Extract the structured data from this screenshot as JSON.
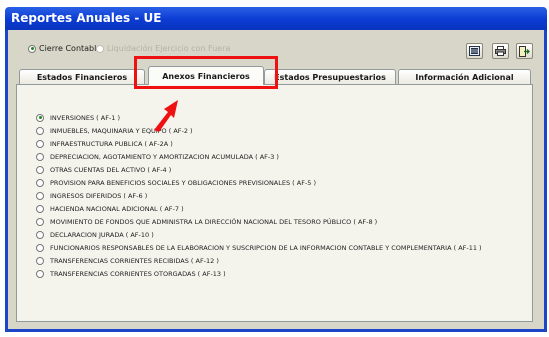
{
  "window": {
    "title": "Reportes Anuales - UE"
  },
  "options": [
    {
      "label": "Cierre Contable",
      "selected": true,
      "enabled": true
    },
    {
      "label": "Liquidación Ejercicio con Fuera",
      "selected": false,
      "enabled": false
    }
  ],
  "toolbar": {
    "buttons": [
      {
        "icon": "table-icon"
      },
      {
        "icon": "print-icon"
      },
      {
        "icon": "exit-icon"
      }
    ]
  },
  "tabs": [
    {
      "label": "Estados Financieros",
      "active": false
    },
    {
      "label": "Anexos Financieros",
      "active": true
    },
    {
      "label": "Estados Presupuestarios",
      "active": false
    },
    {
      "label": "Información Adicional",
      "active": false
    }
  ],
  "annexes": [
    {
      "label": "INVERSIONES ( AF-1 )",
      "selected": true
    },
    {
      "label": "INMUEBLES, MAQUINARIA Y EQUIPO ( AF-2 )",
      "selected": false
    },
    {
      "label": "INFRAESTRUCTURA PUBLICA ( AF-2A )",
      "selected": false
    },
    {
      "label": "DEPRECIACION, AGOTAMIENTO Y AMORTIZACION ACUMULADA ( AF-3 )",
      "selected": false
    },
    {
      "label": "OTRAS CUENTAS DEL ACTIVO ( AF-4 )",
      "selected": false
    },
    {
      "label": "PROVISION PARA BENEFICIOS SOCIALES Y OBLIGACIONES PREVISIONALES ( AF-5 )",
      "selected": false
    },
    {
      "label": "INGRESOS DIFERIDOS ( AF-6 )",
      "selected": false
    },
    {
      "label": "HACIENDA NACIONAL ADICIONAL ( AF-7 )",
      "selected": false
    },
    {
      "label": "MOVIMIENTO DE FONDOS QUE ADMINISTRA LA DIRECCIÓN NACIONAL DEL TESORO PÚBLICO ( AF-8 )",
      "selected": false
    },
    {
      "label": "DECLARACION JURADA ( AF-10 )",
      "selected": false
    },
    {
      "label": "FUNCIONARIOS RESPONSABLES DE LA ELABORACION Y SUSCRIPCION DE LA INFORMACION CONTABLE Y COMPLEMENTARIA ( AF-11 )",
      "selected": false
    },
    {
      "label": "TRANSFERENCIAS CORRIENTES RECIBIDAS ( AF-12 )",
      "selected": false
    },
    {
      "label": "TRANSFERENCIAS CORRIENTES OTORGADAS ( AF-13 )",
      "selected": false
    }
  ],
  "colors": {
    "titlebar": "#0b3bd2",
    "highlight": "#ef1111",
    "panel": "#f4f3ec",
    "frame": "#d8d6c8"
  }
}
